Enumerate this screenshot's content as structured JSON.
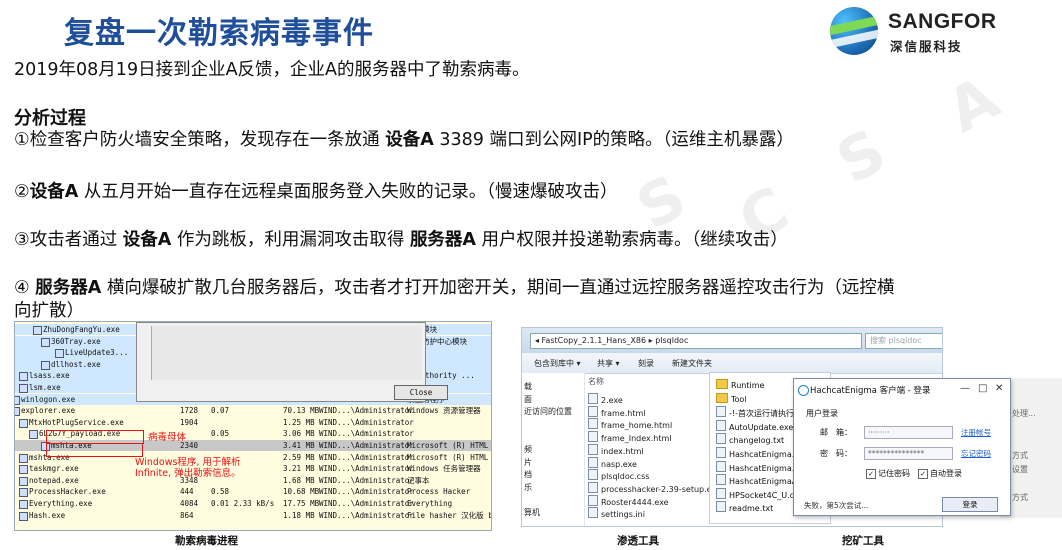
{
  "slide": {
    "title": "复盘一次勒索病毒事件",
    "intro": "2019年08月19日接到企业A反馈，企业A的服务器中了勒索病毒。",
    "section_heading": "分析过程",
    "step1": {
      "pre": "①检查客户防火墙安全策略，发现存在一条放通 ",
      "b1": "设备A",
      "post": " 3389 端口到公网IP的策略。（运维主机暴露）"
    },
    "step2": {
      "pre": "②",
      "b1": "设备A",
      "post": " 从五月开始一直存在远程桌面服务登入失败的记录。（慢速爆破攻击）"
    },
    "step3": {
      "pre": "③攻击者通过 ",
      "b1": "设备A",
      "mid": " 作为跳板，利用漏洞攻击取得 ",
      "b2": "服务器A",
      "post": " 用户权限并投递勒索病毒。（继续攻击）"
    },
    "step4": {
      "pre": "④ ",
      "b1": "服务器A",
      "post1": " 横向爆破扩散几台服务器后，攻击者才打开加密开关，期间一直通过远控服务器遥控攻击行为（远控横",
      "post2": "向扩散）"
    }
  },
  "logo": {
    "brand": "SANGFOR",
    "brand_cn": "深信服科技"
  },
  "watermark": {
    "letters": [
      "S",
      "C",
      "S",
      "A"
    ]
  },
  "process_screenshot": {
    "caption": "勒索病毒进程",
    "dialog_button": "Close",
    "rows": [
      {
        "name": "ZhuDongFangYu.exe",
        "pid": "",
        "cpu": "",
        "priv": "",
        "user": "",
        "desc": "服务模块"
      },
      {
        "name": "360Tray.exe",
        "pid": "",
        "cpu": "",
        "priv": "",
        "user": "",
        "desc": "安全防护中心模块"
      },
      {
        "name": "LiveUpdate3...",
        "pid": "",
        "cpu": "",
        "priv": "",
        "user": "",
        "desc": ""
      },
      {
        "name": "dllhost.exe",
        "pid": "",
        "cpu": "",
        "priv": "",
        "user": "",
        "desc": ""
      },
      {
        "name": "lsass.exe",
        "pid": "",
        "cpu": "",
        "priv": "",
        "user": "",
        "desc": "y Authority ..."
      },
      {
        "name": "lsm.exe",
        "pid": "",
        "cpu": "",
        "priv": "",
        "user": "",
        "desc": "服务"
      },
      {
        "name": "winlogon.exe",
        "pid": "",
        "cpu": "",
        "priv": "",
        "user": "",
        "desc": "录应用程序"
      },
      {
        "name": "explorer.exe",
        "pid": "1728",
        "cpu": "0.07",
        "priv": "70.13 MB",
        "user": "WIND...\\Administrator",
        "desc": "Windows 资源管理器"
      },
      {
        "name": "MtxHotPlugService.exe",
        "pid": "1904",
        "cpu": "",
        "priv": "1.25 MB",
        "user": "WIND...\\Administrator",
        "desc": ""
      },
      {
        "name": "6L2G7Y_payload.exe",
        "pid": "",
        "cpu": "0.05",
        "priv": "3.06 MB",
        "user": "WIND...\\Administrator",
        "desc": ""
      },
      {
        "name": "mshta.exe",
        "pid": "2340",
        "cpu": "",
        "priv": "3.41 MB",
        "user": "WIND...\\Administrator",
        "desc": "Microsoft (R) HTML 应用程..."
      },
      {
        "name": "mshta.exe",
        "pid": "",
        "cpu": "",
        "priv": "2.59 MB",
        "user": "WIND...\\Administrator",
        "desc": "Microsoft (R) HTML 应用程..."
      },
      {
        "name": "taskmgr.exe",
        "pid": "",
        "cpu": "",
        "priv": "3.21 MB",
        "user": "WIND...\\Administrator",
        "desc": "Windows 任务管理器"
      },
      {
        "name": "notepad.exe",
        "pid": "3348",
        "cpu": "",
        "priv": "1.68 MB",
        "user": "WIND...\\Administrator",
        "desc": "记事本"
      },
      {
        "name": "ProcessHacker.exe",
        "pid": "444",
        "cpu": "0.58",
        "priv": "10.68 MB",
        "user": "WIND...\\Administrator",
        "desc": "Process Hacker"
      },
      {
        "name": "Everything.exe",
        "pid": "4084",
        "cpu": "0.01   2.33 kB/s",
        "priv": "17.75 MB",
        "user": "WIND...\\Administrator",
        "desc": "Everything"
      },
      {
        "name": "Hash.exe",
        "pid": "864",
        "cpu": "",
        "priv": "1.18 MB",
        "user": "WIND...\\Administrator",
        "desc": "File hasher 汉化版 by nig..."
      }
    ],
    "annotations": {
      "virus_parent": "病毒母体",
      "windows_note_1": "Windows程序, 用于解析",
      "windows_note_2": "Infinite, 弹出勒索信息。"
    }
  },
  "explorer_screenshot": {
    "caption": "渗透工具",
    "address": "◂ FastCopy_2.1.1_Hans_X86 ▸ plsqldoc",
    "search_placeholder": "搜索 plsqldoc",
    "toolbar": [
      "包含到库中 ▾",
      "共享 ▾",
      "刻录",
      "新建文件夹"
    ],
    "nav_items": [
      "载",
      "面",
      "近访问的位置",
      "",
      "",
      "频",
      "片",
      "档",
      "乐",
      "",
      "算机"
    ],
    "column_header": "名称",
    "files": [
      "2.exe",
      "frame.html",
      "frame_home.html",
      "frame_Index.html",
      "index.html",
      "nasp.exe",
      "plsqldoc.css",
      "processhacker-2.39-setup.exe",
      "Rooster4444.exe",
      "settings.ini"
    ]
  },
  "mining_screenshot": {
    "caption": "挖矿工具",
    "list_files": [
      "Runtime",
      "Tool",
      "-!-首次运行请执行",
      "AutoUpdate.exe",
      "changelog.txt",
      "HashcatEnigma.h",
      "HashcatEnigma.h",
      "HashcatEnigmaA",
      "HPSocket4C_U.dl",
      "readme.txt"
    ],
    "login": {
      "title": "HachcatEnigma 客户端 - 登录",
      "group": "用户登录",
      "email_label": "邮　箱：",
      "email_value": "·········",
      "password_label": "密　码：",
      "password_value": "***************",
      "register_link": "注册帐号",
      "forgot_link": "忘记密码",
      "remember_label": "记住密码",
      "auto_label": "自动登录",
      "status": "失败，第5次尝试...",
      "login_button": "登录"
    },
    "background_text": [
      "处理...",
      "方式",
      "设置",
      "方式"
    ]
  }
}
